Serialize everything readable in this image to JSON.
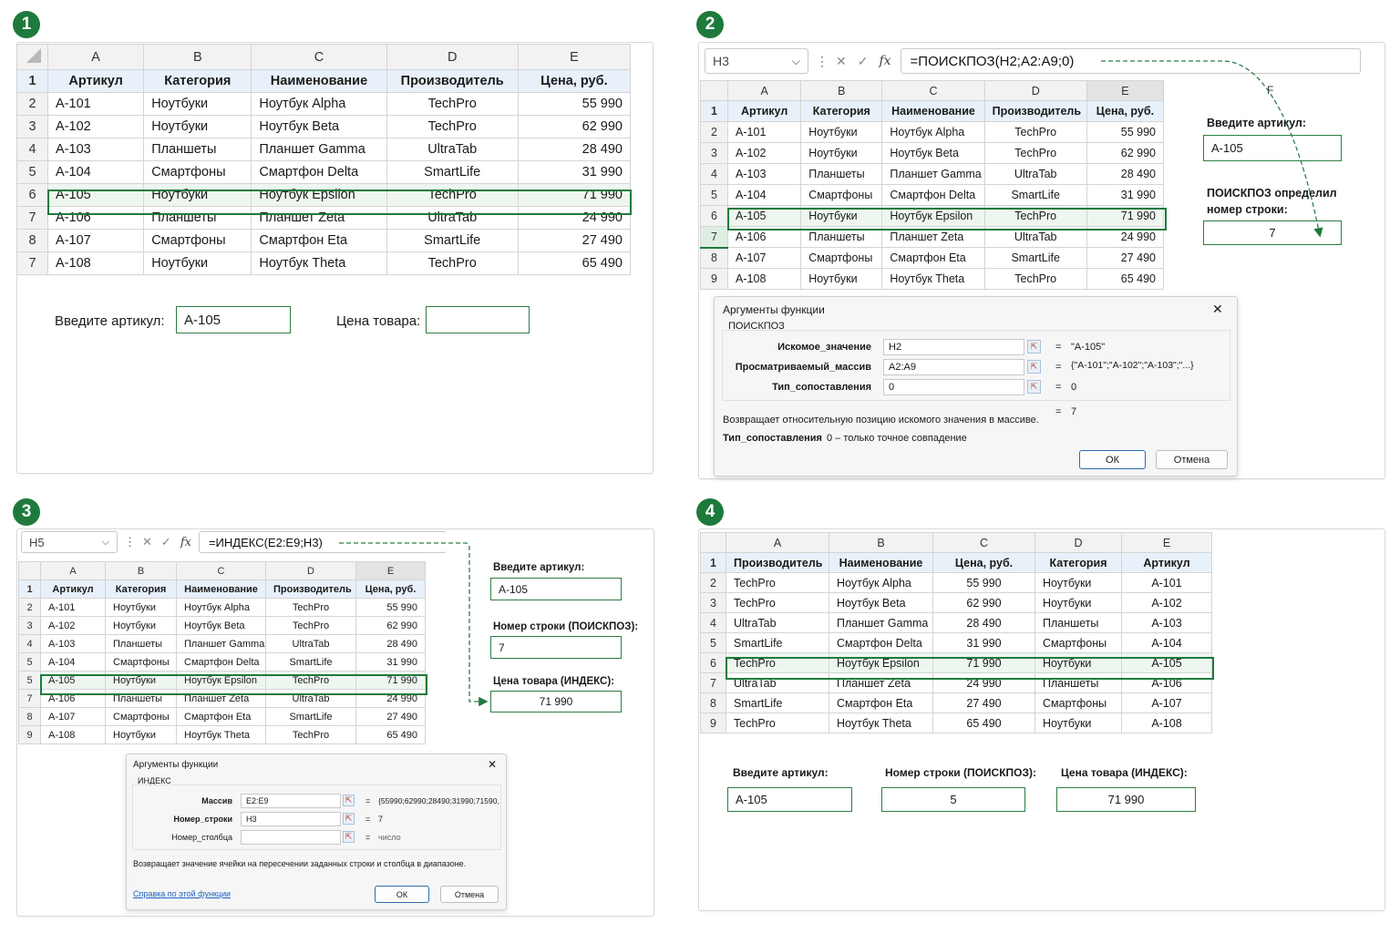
{
  "badges": [
    "1",
    "2",
    "3",
    "4"
  ],
  "p1": {
    "cols": [
      "A",
      "B",
      "C",
      "D",
      "E"
    ],
    "headers": [
      "Артикул",
      "Категория",
      "Наименование",
      "Производитель",
      "Цена, руб."
    ],
    "rows": [
      {
        "n": "2",
        "c": [
          "A-101",
          "Ноутбуки",
          "Ноутбук Alpha",
          "TechPro",
          "55 990"
        ]
      },
      {
        "n": "3",
        "c": [
          "A-102",
          "Ноутбуки",
          "Ноутбук Beta",
          "TechPro",
          "62 990"
        ]
      },
      {
        "n": "4",
        "c": [
          "A-103",
          "Планшеты",
          "Планшет Gamma",
          "UltraTab",
          "28 490"
        ]
      },
      {
        "n": "5",
        "c": [
          "A-104",
          "Смартфоны",
          "Смартфон Delta",
          "SmartLife",
          "31 990"
        ]
      },
      {
        "n": "6",
        "c": [
          "A-105",
          "Ноутбуки",
          "Ноутбук Epsilon",
          "TechPro",
          "71 990"
        ]
      },
      {
        "n": "7",
        "c": [
          "A-106",
          "Планшеты",
          "Планшет Zeta",
          "UltraTab",
          "24 990"
        ]
      },
      {
        "n": "8",
        "c": [
          "A-107",
          "Смартфоны",
          "Смартфон Eta",
          "SmartLife",
          "27 490"
        ]
      },
      {
        "n": "7",
        "c": [
          "A-108",
          "Ноутбуки",
          "Ноутбук Theta",
          "TechPro",
          "65 490"
        ]
      }
    ],
    "hdr_row": "1",
    "input_label": "Введите артикул:",
    "input_value": "A-105",
    "price_label": "Цена товара:",
    "price_value": ""
  },
  "p2": {
    "namebox": "H3",
    "formula": "=ПОИСКПОЗ(H2;A2:A9;0)",
    "cols": [
      "A",
      "B",
      "C",
      "D",
      "E",
      "F"
    ],
    "headers": [
      "Артикул",
      "Категория",
      "Наименование",
      "Производитель",
      "Цена, руб."
    ],
    "rows": [
      {
        "n": "2",
        "c": [
          "A-101",
          "Ноутбуки",
          "Ноутбук Alpha",
          "TechPro",
          "55 990"
        ]
      },
      {
        "n": "3",
        "c": [
          "A-102",
          "Ноутбуки",
          "Ноутбук Beta",
          "TechPro",
          "62 990"
        ]
      },
      {
        "n": "4",
        "c": [
          "A-103",
          "Планшеты",
          "Планшет Gamma",
          "UltraTab",
          "28 490"
        ]
      },
      {
        "n": "5",
        "c": [
          "A-104",
          "Смартфоны",
          "Смартфон Delta",
          "SmartLife",
          "31 990"
        ]
      },
      {
        "n": "6",
        "c": [
          "A-105",
          "Ноутбуки",
          "Ноутбук Epsilon",
          "TechPro",
          "71 990"
        ]
      },
      {
        "n": "7",
        "c": [
          "A-106",
          "Планшеты",
          "Планшет Zeta",
          "UltraTab",
          "24 990"
        ]
      },
      {
        "n": "8",
        "c": [
          "A-107",
          "Смартфоны",
          "Смартфон Eta",
          "SmartLife",
          "27 490"
        ]
      },
      {
        "n": "9",
        "c": [
          "A-108",
          "Ноутбуки",
          "Ноутбук Theta",
          "TechPro",
          "65 490"
        ]
      }
    ],
    "hdr_row": "1",
    "input_label": "Введите артикул:",
    "input_value": "A-105",
    "result_label_1": "ПОИСКПОЗ определил",
    "result_label_2": "номер строки:",
    "result_value": "7",
    "dialog": {
      "title": "Аргументы функции",
      "func": "ПОИСКПОЗ",
      "args": [
        {
          "label": "Искомое_значение",
          "value": "H2",
          "eq": "=",
          "result": "\"A-105\""
        },
        {
          "label": "Просматриваемый_массив",
          "value": "A2:A9",
          "eq": "=",
          "result": "{\"A-101\";\"A-102\";\"A-103\";\"...}"
        },
        {
          "label": "Тип_сопоставления",
          "value": "0",
          "eq": "=",
          "result": "0"
        }
      ],
      "total_eq": "=",
      "total": "7",
      "description": "Возвращает относительную позицию искомого значения в массиве.",
      "param_name": "Тип_сопоставления",
      "param_desc": "0 – только точное совпадение",
      "ok": "ОК",
      "cancel": "Отмена"
    }
  },
  "p3": {
    "namebox": "H5",
    "formula": "=ИНДЕКС(E2:E9;H3)",
    "cols": [
      "A",
      "B",
      "C",
      "D",
      "E"
    ],
    "headers": [
      "Артикул",
      "Категория",
      "Наименование",
      "Производитель",
      "Цена, руб."
    ],
    "rows": [
      {
        "n": "2",
        "c": [
          "A-101",
          "Ноутбуки",
          "Ноутбук Alpha",
          "TechPro",
          "55 990"
        ]
      },
      {
        "n": "3",
        "c": [
          "A-102",
          "Ноутбуки",
          "Ноутбук Beta",
          "TechPro",
          "62 990"
        ]
      },
      {
        "n": "4",
        "c": [
          "A-103",
          "Планшеты",
          "Планшет Gamma",
          "UltraTab",
          "28 490"
        ]
      },
      {
        "n": "5",
        "c": [
          "A-104",
          "Смартфоны",
          "Смартфон Delta",
          "SmartLife",
          "31 990"
        ]
      },
      {
        "n": "5",
        "c": [
          "A-105",
          "Ноутбуки",
          "Ноутбук Epsilon",
          "TechPro",
          "71 990"
        ]
      },
      {
        "n": "7",
        "c": [
          "A-106",
          "Планшеты",
          "Планшет Zeta",
          "UltraTab",
          "24 990"
        ]
      },
      {
        "n": "8",
        "c": [
          "A-107",
          "Смартфоны",
          "Смартфон Eta",
          "SmartLife",
          "27 490"
        ]
      },
      {
        "n": "9",
        "c": [
          "A-108",
          "Ноутбуки",
          "Ноутбук Theta",
          "TechPro",
          "65 490"
        ]
      }
    ],
    "hdr_row": "1",
    "input_label": "Введите артикул:",
    "input_value": "A-105",
    "row_label": "Номер строки (ПОИСКПОЗ):",
    "row_value": "7",
    "price_label": "Цена товара (ИНДЕКС):",
    "price_value": "71 990",
    "dialog": {
      "title": "Аргументы функции",
      "func": "ИНДЕКС",
      "args": [
        {
          "label": "Массив",
          "value": "E2:E9",
          "eq": "=",
          "result": "{55990;62990;28490;31990;71590,"
        },
        {
          "label": "Номер_строки",
          "value": "H3",
          "eq": "=",
          "result": "7"
        },
        {
          "label": "Номер_столбца",
          "value": "",
          "eq": "=",
          "result": "число"
        }
      ],
      "description": "Возвращает значение ячейки на пересечении заданных строки и столбца в диапазоне.",
      "help": "Справка по этой функции",
      "ok": "ОК",
      "cancel": "Отмена"
    }
  },
  "p4": {
    "cols": [
      "A",
      "B",
      "C",
      "D",
      "E"
    ],
    "headers": [
      "Производитель",
      "Наименование",
      "Цена, руб.",
      "Категория",
      "Артикул"
    ],
    "rows": [
      {
        "n": "2",
        "c": [
          "TechPro",
          "Ноутбук Alpha",
          "55 990",
          "Ноутбуки",
          "A-101"
        ]
      },
      {
        "n": "3",
        "c": [
          "TechPro",
          "Ноутбук Beta",
          "62 990",
          "Ноутбуки",
          "A-102"
        ]
      },
      {
        "n": "4",
        "c": [
          "UltraTab",
          "Планшет Gamma",
          "28 490",
          "Планшеты",
          "A-103"
        ]
      },
      {
        "n": "5",
        "c": [
          "SmartLife",
          "Смартфон Delta",
          "31 990",
          "Смартфоны",
          "A-104"
        ]
      },
      {
        "n": "6",
        "c": [
          "TechPro",
          "Ноутбук Epsilon",
          "71 990",
          "Ноутбуки",
          "A-105"
        ]
      },
      {
        "n": "7",
        "c": [
          "UltraTab",
          "Планшет Zeta",
          "24 990",
          "Планшеты",
          "A-106"
        ]
      },
      {
        "n": "8",
        "c": [
          "SmartLife",
          "Смартфон Eta",
          "27 490",
          "Смартфоны",
          "A-107"
        ]
      },
      {
        "n": "9",
        "c": [
          "TechPro",
          "Ноутбук Theta",
          "65 490",
          "Ноутбуки",
          "A-108"
        ]
      }
    ],
    "hdr_row": "1",
    "input_label": "Введите артикул:",
    "input_value": "A-105",
    "row_label": "Номер строки (ПОИСКПОЗ):",
    "row_value": "5",
    "price_label": "Цена товара (ИНДЕКС):",
    "price_value": "71 990"
  },
  "icons": {
    "cancel": "✕",
    "confirm": "✓",
    "fx": "fx",
    "dropdown": "⌵",
    "more": "⋮",
    "close": "✕",
    "collapse": "⇱"
  },
  "colors": {
    "accent": "#1e7a3c",
    "header_fill": "#e8f1f9",
    "highlight_fill": "#eef7ef"
  }
}
